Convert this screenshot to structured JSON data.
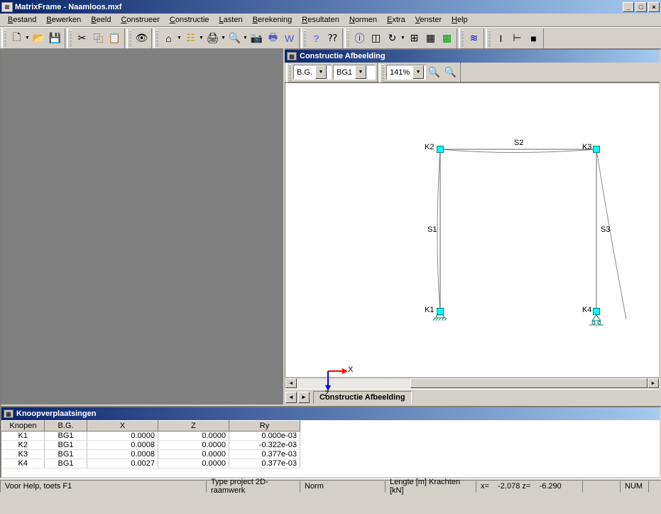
{
  "title": "MatrixFrame - Naamloos.mxf",
  "menu": [
    "Bestand",
    "Bewerken",
    "Beeld",
    "Construeer",
    "Constructie",
    "Lasten",
    "Berekening",
    "Resultaten",
    "Normen",
    "Extra",
    "Venster",
    "Help"
  ],
  "viewport": {
    "title": "Constructie Afbeelding",
    "combo1": "B.G.",
    "combo2": "BG1",
    "zoom": "141%",
    "tab": "Constructie Afbeelding",
    "axis_x": "X",
    "axis_z": "Z",
    "nodes": [
      "K1",
      "K2",
      "K3",
      "K4"
    ],
    "members": [
      "S1",
      "S2",
      "S3"
    ]
  },
  "table": {
    "title": "Knoopverplaatsingen",
    "headers": [
      "Knopen",
      "B.G.",
      "X",
      "Z",
      "Ry"
    ],
    "rows": [
      [
        "K1",
        "BG1",
        "0.0000",
        "0.0000",
        "0.000e-03"
      ],
      [
        "K2",
        "BG1",
        "0.0008",
        "0.0000",
        "-0.322e-03"
      ],
      [
        "K3",
        "BG1",
        "0.0008",
        "0.0000",
        "0.377e-03"
      ],
      [
        "K4",
        "BG1",
        "0.0027",
        "0.0000",
        "0.377e-03"
      ]
    ]
  },
  "status": {
    "help": "Voor Help, toets F1",
    "project": "Type project 2D-raamwerk",
    "norm": "Norm",
    "units": "Lengte [m] Krachten [kN]",
    "coords": "x=    -2.078 z=    -6.290",
    "num": "NUM"
  }
}
